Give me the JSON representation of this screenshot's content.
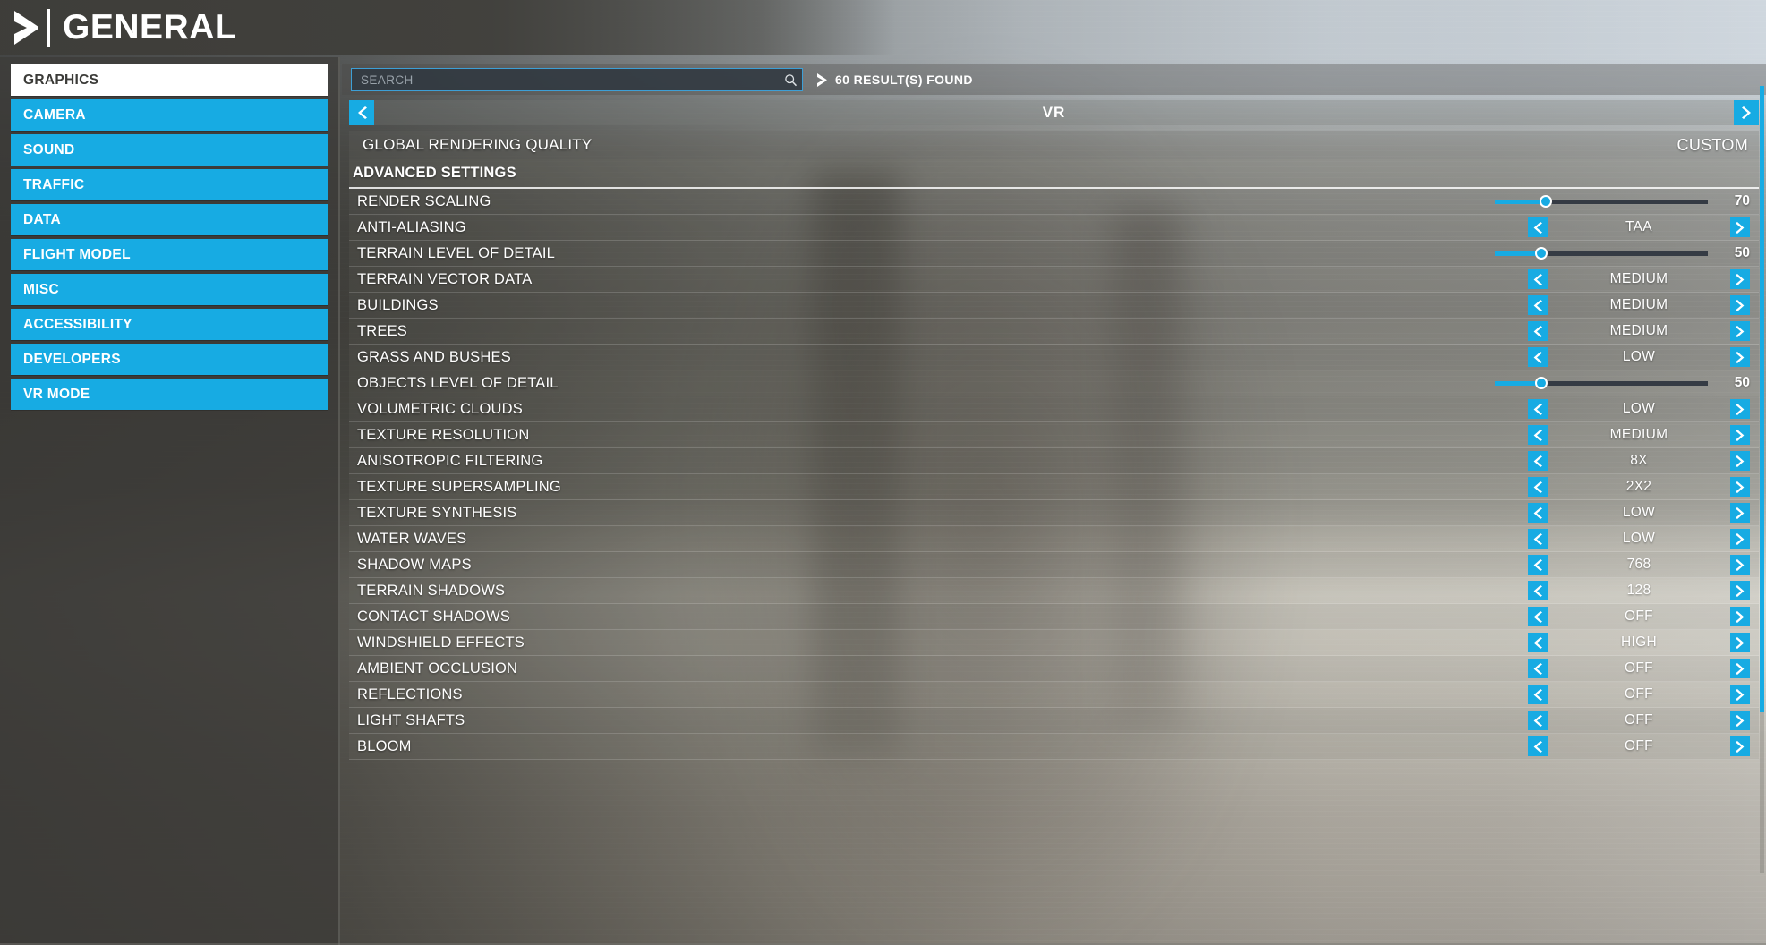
{
  "header": {
    "title": "GENERAL",
    "logo_icon": "chevron-right-logo-icon"
  },
  "sidebar": {
    "items": [
      {
        "label": "GRAPHICS",
        "active": true
      },
      {
        "label": "CAMERA",
        "active": false
      },
      {
        "label": "SOUND",
        "active": false
      },
      {
        "label": "TRAFFIC",
        "active": false
      },
      {
        "label": "DATA",
        "active": false
      },
      {
        "label": "FLIGHT MODEL",
        "active": false
      },
      {
        "label": "MISC",
        "active": false
      },
      {
        "label": "ACCESSIBILITY",
        "active": false
      },
      {
        "label": "DEVELOPERS",
        "active": false
      },
      {
        "label": "VR MODE",
        "active": false
      }
    ]
  },
  "search": {
    "value": "",
    "placeholder": "SEARCH",
    "icon": "magnifier-icon",
    "results_text": "60 RESULT(S) FOUND",
    "results_icon": "chevron-right-icon"
  },
  "tabbar": {
    "title": "VR",
    "prev_icon": "chevron-left-icon",
    "next_icon": "chevron-right-icon"
  },
  "colors": {
    "accent": "#17abe3",
    "accent_text": "#ffffff",
    "panel": "#6c6c66",
    "slider_track": "#353b44"
  },
  "settings": [
    {
      "label": "GLOBAL RENDERING QUALITY",
      "type": "quality",
      "value": "CUSTOM"
    },
    {
      "label": "ADVANCED SETTINGS",
      "type": "section"
    },
    {
      "label": "RENDER SCALING",
      "type": "slider",
      "value": 70,
      "min": 0,
      "max": 100,
      "percent": 24
    },
    {
      "label": "ANTI-ALIASING",
      "type": "spinner",
      "value": "TAA"
    },
    {
      "label": "TERRAIN LEVEL OF DETAIL",
      "type": "slider",
      "value": 50,
      "min": 0,
      "max": 100,
      "percent": 22
    },
    {
      "label": "TERRAIN VECTOR DATA",
      "type": "spinner",
      "value": "MEDIUM"
    },
    {
      "label": "BUILDINGS",
      "type": "spinner",
      "value": "MEDIUM"
    },
    {
      "label": "TREES",
      "type": "spinner",
      "value": "MEDIUM"
    },
    {
      "label": "GRASS AND BUSHES",
      "type": "spinner",
      "value": "LOW"
    },
    {
      "label": "OBJECTS LEVEL OF DETAIL",
      "type": "slider",
      "value": 50,
      "min": 0,
      "max": 100,
      "percent": 22
    },
    {
      "label": "VOLUMETRIC CLOUDS",
      "type": "spinner",
      "value": "LOW"
    },
    {
      "label": "TEXTURE RESOLUTION",
      "type": "spinner",
      "value": "MEDIUM"
    },
    {
      "label": "ANISOTROPIC FILTERING",
      "type": "spinner",
      "value": "8X"
    },
    {
      "label": "TEXTURE SUPERSAMPLING",
      "type": "spinner",
      "value": "2X2"
    },
    {
      "label": "TEXTURE SYNTHESIS",
      "type": "spinner",
      "value": "LOW"
    },
    {
      "label": "WATER WAVES",
      "type": "spinner",
      "value": "LOW"
    },
    {
      "label": "SHADOW MAPS",
      "type": "spinner",
      "value": "768"
    },
    {
      "label": "TERRAIN SHADOWS",
      "type": "spinner",
      "value": "128"
    },
    {
      "label": "CONTACT SHADOWS",
      "type": "spinner",
      "value": "OFF"
    },
    {
      "label": "WINDSHIELD EFFECTS",
      "type": "spinner",
      "value": "HIGH"
    },
    {
      "label": "AMBIENT OCCLUSION",
      "type": "spinner",
      "value": "OFF"
    },
    {
      "label": "REFLECTIONS",
      "type": "spinner",
      "value": "OFF"
    },
    {
      "label": "LIGHT SHAFTS",
      "type": "spinner",
      "value": "OFF"
    },
    {
      "label": "BLOOM",
      "type": "spinner",
      "value": "OFF"
    }
  ]
}
